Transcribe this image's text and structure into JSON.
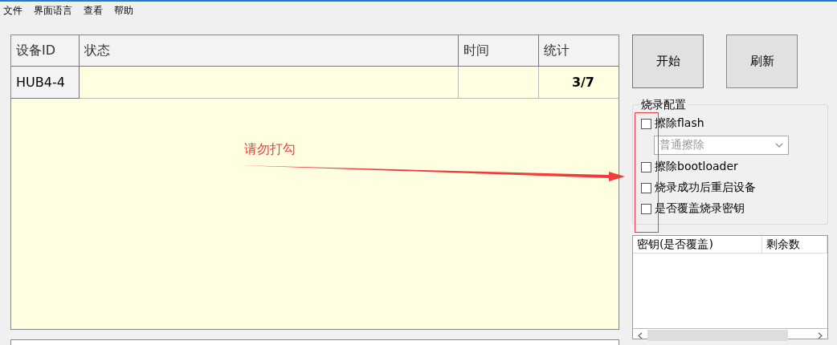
{
  "menu": [
    "文件",
    "界面语言",
    "查看",
    "帮助"
  ],
  "device_table": {
    "columns": [
      "设备ID",
      "状态",
      "时间",
      "统计"
    ],
    "rows": [
      [
        "HUB4-4",
        "",
        "",
        "3/7"
      ]
    ]
  },
  "buttons": [
    "开始",
    "刷新"
  ],
  "burn_config": {
    "title": "烧录配置",
    "options": [
      {
        "kind": "checkbox",
        "label": "擦除flash",
        "checked": false
      },
      {
        "kind": "select",
        "value": "普通擦除",
        "disabled": true
      },
      {
        "kind": "checkbox",
        "label": "擦除bootloader",
        "checked": false
      },
      {
        "kind": "checkbox",
        "label": "烧录成功后重启设备",
        "checked": false
      },
      {
        "kind": "checkbox",
        "label": "是否覆盖烧录密钥",
        "checked": false
      }
    ]
  },
  "key_table": {
    "columns": [
      "密钥(是否覆盖)",
      "剩余数"
    ]
  },
  "annotation": {
    "text": "请勿打勾"
  }
}
